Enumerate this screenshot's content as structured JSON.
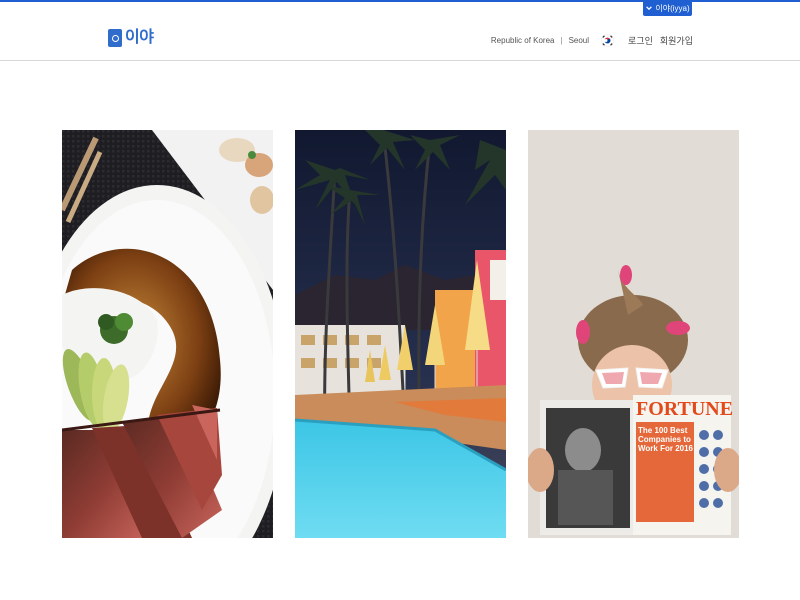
{
  "header": {
    "language_tab": "이야(iyya)",
    "logo_text": "이야",
    "location_country": "Republic of Korea",
    "location_separator": "|",
    "location_city": "Seoul",
    "login_label": "로그인",
    "signup_label": "회원가입"
  },
  "cards": [
    {
      "subject": "seared tuna dish"
    },
    {
      "subject": "hotel swimming pool"
    },
    {
      "subject": "woman reading magazine"
    }
  ],
  "magazine": {
    "title": "FORTUNE",
    "headline": "The 100 Best Companies to Work For 2016"
  },
  "colors": {
    "accent": "#1f5fd1",
    "logo": "#2f6ccb"
  }
}
